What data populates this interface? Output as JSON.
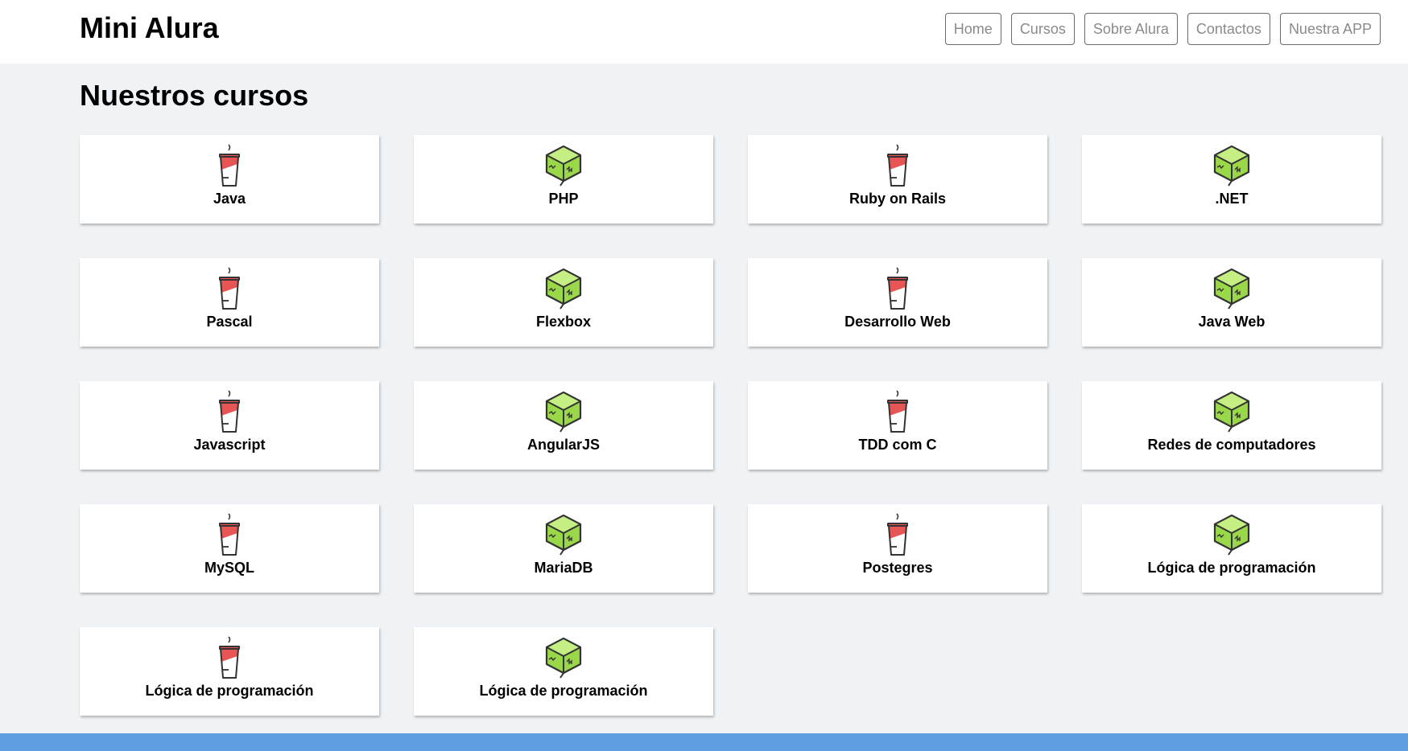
{
  "header": {
    "logo": "Mini Alura",
    "nav": [
      "Home",
      "Cursos",
      "Sobre Alura",
      "Contactos",
      "Nuestra APP"
    ]
  },
  "main": {
    "title": "Nuestros cursos",
    "courses": [
      {
        "label": "Java",
        "icon": "coffee-cup-icon"
      },
      {
        "label": "PHP",
        "icon": "green-cube-icon"
      },
      {
        "label": "Ruby on Rails",
        "icon": "coffee-cup-icon"
      },
      {
        "label": ".NET",
        "icon": "green-cube-icon"
      },
      {
        "label": "Pascal",
        "icon": "coffee-cup-icon"
      },
      {
        "label": "Flexbox",
        "icon": "green-cube-icon"
      },
      {
        "label": "Desarrollo Web",
        "icon": "coffee-cup-icon"
      },
      {
        "label": "Java Web",
        "icon": "green-cube-icon"
      },
      {
        "label": "Javascript",
        "icon": "coffee-cup-icon"
      },
      {
        "label": "AngularJS",
        "icon": "green-cube-icon"
      },
      {
        "label": "TDD com C",
        "icon": "coffee-cup-icon"
      },
      {
        "label": "Redes de computadores",
        "icon": "green-cube-icon"
      },
      {
        "label": "MySQL",
        "icon": "coffee-cup-icon"
      },
      {
        "label": "MariaDB",
        "icon": "green-cube-icon"
      },
      {
        "label": "Postegres",
        "icon": "coffee-cup-icon"
      },
      {
        "label": "Lógica de programación",
        "icon": "green-cube-icon"
      },
      {
        "label": "Lógica de programación",
        "icon": "coffee-cup-icon"
      },
      {
        "label": "Lógica de programación",
        "icon": "green-cube-icon"
      }
    ]
  },
  "colors": {
    "page_background": "#f0f3f6",
    "header_background": "#ffffff",
    "footer_bar": "#5f9ee0",
    "cup_red": "#e85555",
    "cube_green": "#9ad84a",
    "icon_outline": "#333333"
  }
}
